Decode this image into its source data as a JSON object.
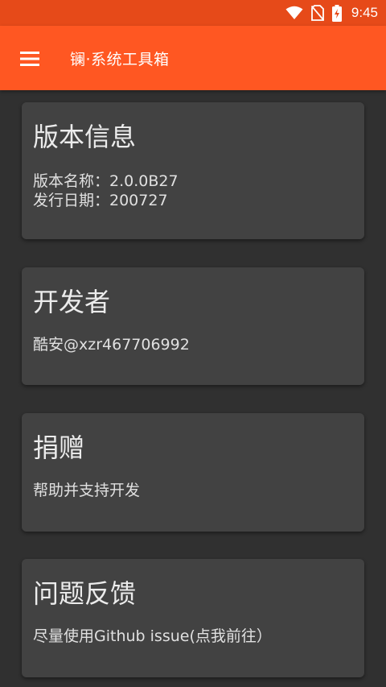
{
  "status_bar": {
    "time": "9:45",
    "icons": [
      "wifi-icon",
      "no-sim-icon",
      "battery-charging-icon"
    ]
  },
  "app_bar": {
    "menu_icon": "hamburger-menu-icon",
    "title": "镧·系统工具箱"
  },
  "cards": {
    "version": {
      "title": "版本信息",
      "lines": [
        "版本名称：2.0.0B27",
        "发行日期：200727"
      ]
    },
    "developer": {
      "title": "开发者",
      "lines": [
        "酷安@xzr467706992"
      ]
    },
    "donate": {
      "title": "捐赠",
      "lines": [
        "帮助并支持开发"
      ]
    },
    "feedback": {
      "title": "问题反馈",
      "lines": [
        "尽量使用Github issue(点我前往）"
      ]
    }
  },
  "colors": {
    "status_bar": "#E64A19",
    "app_bar": "#FF5722",
    "background": "#303030",
    "card": "#424242"
  }
}
